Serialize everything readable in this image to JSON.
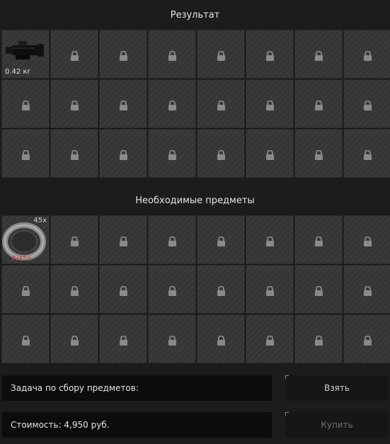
{
  "result_title": "Результат",
  "required_title": "Необходимые предметы",
  "result_item": {
    "weight": "0.42 кг"
  },
  "required_item": {
    "count": "45x",
    "progress": "0/45x"
  },
  "task_label": "Задача по сбору предметов:",
  "cost_label": "Стоимость: 4,950 руб.",
  "take_button": "Взять",
  "buy_button": "Купить",
  "colors": {
    "progress_red": "#c03a3a",
    "buy_disabled": "#6e6e6e",
    "take_text": "#cfcfcf"
  }
}
